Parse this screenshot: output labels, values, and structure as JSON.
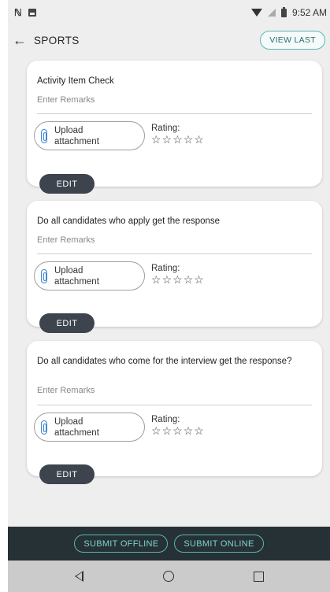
{
  "status_bar": {
    "time": "9:52 AM",
    "left_icons": [
      "n-icon",
      "image-icon"
    ],
    "right_icons": [
      "wifi-icon",
      "signal-icon",
      "battery-icon"
    ]
  },
  "header": {
    "back_icon": "arrow-left-icon",
    "title": "SPORTS",
    "view_last_label": "VIEW LAST"
  },
  "cards": [
    {
      "question": "Activity Item Check",
      "remarks_placeholder": "Enter Remarks",
      "upload_label": "Upload attachment",
      "rating_label": "Rating:",
      "rating": 0,
      "max_rating": 5,
      "edit_label": "EDIT"
    },
    {
      "question": "Do all candidates who apply get the response",
      "remarks_placeholder": "Enter Remarks",
      "upload_label": "Upload attachment",
      "rating_label": "Rating:",
      "rating": 0,
      "max_rating": 5,
      "edit_label": "EDIT"
    },
    {
      "question": "Do all candidates who come for the interview get the response?",
      "remarks_placeholder": "Enter Remarks",
      "upload_label": "Upload attachment",
      "rating_label": "Rating:",
      "rating": 0,
      "max_rating": 5,
      "edit_label": "EDIT"
    }
  ],
  "footer": {
    "submit_offline_label": "SUBMIT OFFLINE",
    "submit_online_label": "SUBMIT ONLINE"
  },
  "nav_bar": {
    "icons": [
      "back-triangle-icon",
      "home-circle-icon",
      "recents-square-icon"
    ]
  },
  "colors": {
    "accent": "#5bb5b0",
    "edit_button": "#3d444d",
    "footer_bg": "#263136",
    "clip_icon": "#3a86d6"
  }
}
